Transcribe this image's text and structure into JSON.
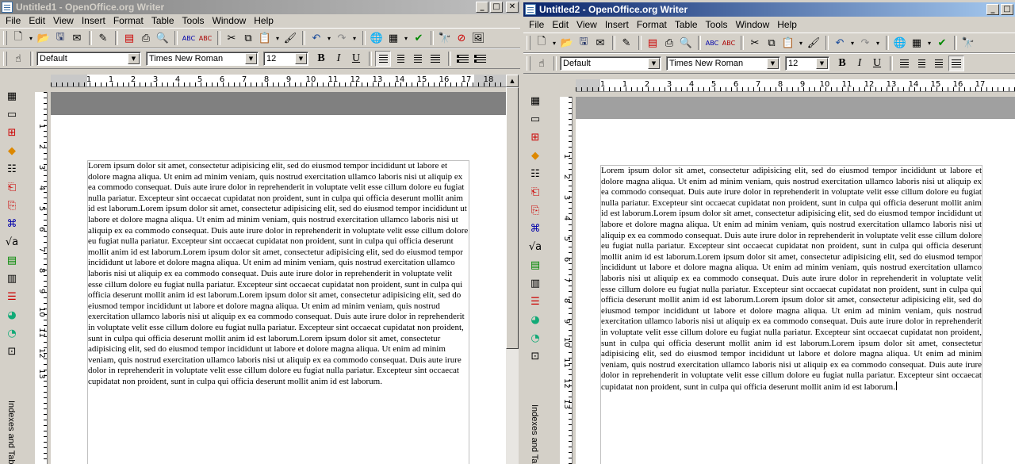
{
  "menu": [
    "File",
    "Edit",
    "View",
    "Insert",
    "Format",
    "Table",
    "Tools",
    "Window",
    "Help"
  ],
  "windows": [
    {
      "title": "Untitled1 - OpenOffice.org Writer",
      "active": false,
      "style": "Default",
      "font": "Times New Roman",
      "size": "12",
      "sidebar_label": "Indexes and Tab",
      "ruler_numbers": [
        "1",
        "1",
        "2",
        "3",
        "4",
        "5",
        "6",
        "7",
        "8",
        "9",
        "10",
        "11",
        "12",
        "13",
        "14",
        "15",
        "16",
        "17",
        "18"
      ],
      "vruler_numbers": [
        "1",
        "2",
        "3",
        "4",
        "5",
        "6",
        "7",
        "8",
        "9",
        "10",
        "11",
        "12",
        "13"
      ],
      "text": "Lorem ipsum dolor sit amet, consectetur adipisicing elit, sed do eiusmod tempor incididunt ut labore et dolore magna aliqua. Ut enim ad minim veniam, quis nostrud exercitation ullamco laboris nisi ut aliquip ex ea commodo consequat. Duis aute irure dolor in reprehenderit in voluptate velit esse cillum dolore eu fugiat nulla pariatur. Excepteur sint occaecat cupidatat non proident, sunt in culpa qui officia deserunt mollit anim id est laborum.Lorem ipsum dolor sit amet, consectetur adipisicing elit, sed do eiusmod tempor incididunt ut labore et dolore magna aliqua. Ut enim ad minim veniam, quis nostrud exercitation ullamco laboris nisi ut aliquip ex ea commodo consequat. Duis aute irure dolor in reprehenderit in voluptate velit esse cillum dolore eu fugiat nulla pariatur. Excepteur sint occaecat cupidatat non proident, sunt in culpa qui officia deserunt mollit anim id est laborum.Lorem ipsum dolor sit amet, consectetur adipisicing elit, sed do eiusmod tempor incididunt ut labore et dolore magna aliqua. Ut enim ad minim veniam, quis nostrud exercitation ullamco laboris nisi ut aliquip ex ea commodo consequat. Duis aute irure dolor in reprehenderit in voluptate velit esse cillum dolore eu fugiat nulla pariatur. Excepteur sint occaecat cupidatat non proident, sunt in culpa qui officia deserunt mollit anim id est laborum.Lorem ipsum dolor sit amet, consectetur adipisicing elit, sed do eiusmod tempor incididunt ut labore et dolore magna aliqua. Ut enim ad minim veniam, quis nostrud exercitation ullamco laboris nisi ut aliquip ex ea commodo consequat. Duis aute irure dolor in reprehenderit in voluptate velit esse cillum dolore eu fugiat nulla pariatur. Excepteur sint occaecat cupidatat non proident, sunt in culpa qui officia deserunt mollit anim id est laborum.Lorem ipsum dolor sit amet, consectetur adipisicing elit, sed do eiusmod tempor incididunt ut labore et dolore magna aliqua. Ut enim ad minim veniam, quis nostrud exercitation ullamco laboris nisi ut aliquip ex ea commodo consequat. Duis aute irure dolor in reprehenderit in voluptate velit esse cillum dolore eu fugiat nulla pariatur. Excepteur sint occaecat cupidatat non proident, sunt in culpa qui officia deserunt mollit anim id est laborum."
    },
    {
      "title": "Untitled2 - OpenOffice.org Writer",
      "active": true,
      "style": "Default",
      "font": "Times New Roman",
      "size": "12",
      "sidebar_label": "Indexes and Ta",
      "ruler_numbers": [
        "1",
        "1",
        "2",
        "3",
        "4",
        "5",
        "6",
        "7",
        "8",
        "9",
        "10",
        "11",
        "12",
        "13",
        "14",
        "15",
        "16",
        "17"
      ],
      "vruler_numbers": [
        "1",
        "2",
        "3",
        "4",
        "5",
        "6",
        "7",
        "8",
        "9",
        "10",
        "11",
        "12",
        "13"
      ],
      "text": "Lorem ipsum dolor sit amet, consectetur adipisicing elit, sed do eiusmod tempor incididunt ut labore et dolore magna aliqua. Ut enim ad minim veniam, quis nostrud exercitation ullamco laboris nisi ut aliquip ex ea commodo consequat. Duis aute irure dolor in reprehenderit in voluptate velit esse cillum dolore eu fugiat nulla pariatur. Excepteur sint occaecat cupidatat non proident, sunt in culpa qui officia deserunt mollit anim id est laborum.Lorem ipsum dolor sit amet, consectetur adipisicing elit, sed do eiusmod tempor incididunt ut labore et dolore magna aliqua. Ut enim ad minim veniam, quis nostrud exercitation ullamco laboris nisi ut aliquip ex ea commodo consequat. Duis aute irure dolor in reprehenderit in voluptate velit esse cillum dolore eu fugiat nulla pariatur. Excepteur sint occaecat cupidatat non proident, sunt in culpa qui officia deserunt mollit anim id est laborum.Lorem ipsum dolor sit amet, consectetur adipisicing elit, sed do eiusmod tempor incididunt ut labore et dolore magna aliqua. Ut enim ad minim veniam, quis nostrud exercitation ullamco laboris nisi ut aliquip ex ea commodo consequat. Duis aute irure dolor in reprehenderit in voluptate velit esse cillum dolore eu fugiat nulla pariatur. Excepteur sint occaecat cupidatat non proident, sunt in culpa qui officia deserunt mollit anim id est laborum.Lorem ipsum dolor sit amet, consectetur adipisicing elit, sed do eiusmod tempor incididunt ut labore et dolore magna aliqua. Ut enim ad minim veniam, quis nostrud exercitation ullamco laboris nisi ut aliquip ex ea commodo consequat. Duis aute irure dolor in reprehenderit in voluptate velit esse cillum dolore eu fugiat nulla pariatur. Excepteur sint occaecat cupidatat non proident, sunt in culpa qui officia deserunt mollit anim id est laborum.Lorem ipsum dolor sit amet, consectetur adipisicing elit, sed do eiusmod tempor incididunt ut labore et dolore magna aliqua. Ut enim ad minim veniam, quis nostrud exercitation ullamco laboris nisi ut aliquip ex ea commodo consequat. Duis aute irure dolor in reprehenderit in voluptate velit esse cillum dolore eu fugiat nulla pariatur. Excepteur sint occaecat cupidatat non proident, sunt in culpa qui officia deserunt mollit anim id est laborum."
    }
  ],
  "icons": {
    "toolbar": [
      "new-doc-icon",
      "open-icon",
      "save-icon",
      "mail-icon",
      "edit-doc-icon",
      "export-pdf-icon",
      "print-icon",
      "print-preview-icon",
      "spellcheck-icon",
      "autospell-icon",
      "cut-icon",
      "copy-icon",
      "paste-icon",
      "format-paintbrush-icon",
      "undo-icon",
      "redo-icon",
      "hyperlink-icon",
      "table-icon",
      "show-draw-functions-icon",
      "find-replace-icon",
      "navigator-icon",
      "gallery-icon"
    ],
    "sidebar": [
      "insert-table-icon",
      "insert-frame-icon",
      "insert-fields-icon",
      "insert-object-icon",
      "insert-section-icon",
      "insert-footnote-icon",
      "insert-endnote-icon",
      "insert-field-cmd-icon",
      "insert-formula-icon",
      "insert-chart-icon",
      "insert-index-icon",
      "numbering-icon",
      "pie-chart-icon",
      "pie-chart2-icon",
      "object-catalog-icon"
    ]
  }
}
